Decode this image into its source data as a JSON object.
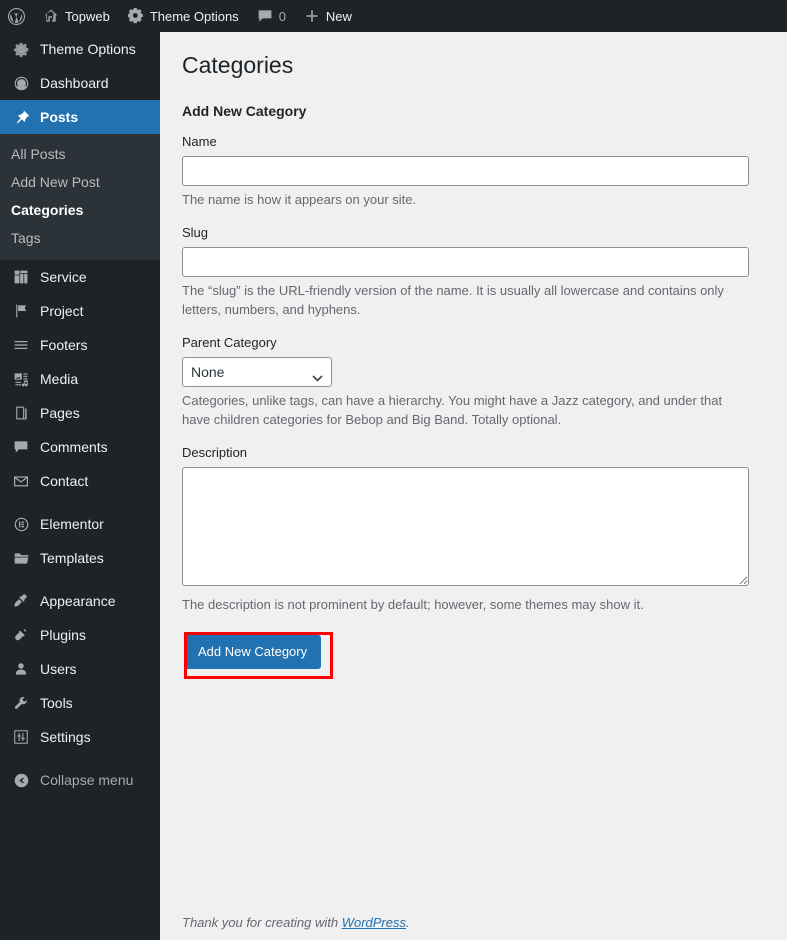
{
  "adminbar": {
    "logo_icon": "wordpress-logo-icon",
    "items": [
      {
        "label": "Topweb",
        "icon": "home-icon"
      },
      {
        "label": "Theme Options",
        "icon": "gear-icon"
      },
      {
        "label": "0",
        "icon": "comment-bubble-icon"
      },
      {
        "label": "New",
        "icon": "plus-icon"
      }
    ]
  },
  "sidebar": {
    "items": [
      {
        "label": "Theme Options",
        "icon": "gear-icon",
        "current": false
      },
      {
        "label": "Dashboard",
        "icon": "dashboard-icon",
        "current": false
      },
      {
        "label": "Posts",
        "icon": "pin-icon",
        "current": true
      },
      {
        "label": "Service",
        "icon": "layout-blocks-icon",
        "current": false
      },
      {
        "label": "Project",
        "icon": "flag-icon",
        "current": false
      },
      {
        "label": "Footers",
        "icon": "menu-lines-icon",
        "current": false
      },
      {
        "label": "Media",
        "icon": "media-icon",
        "current": false
      },
      {
        "label": "Pages",
        "icon": "pages-icon",
        "current": false
      },
      {
        "label": "Comments",
        "icon": "comment-bubble-icon",
        "current": false
      },
      {
        "label": "Contact",
        "icon": "envelope-icon",
        "current": false
      },
      {
        "label": "Elementor",
        "icon": "elementor-icon",
        "current": false
      },
      {
        "label": "Templates",
        "icon": "folder-icon",
        "current": false
      },
      {
        "label": "Appearance",
        "icon": "paintbrush-icon",
        "current": false
      },
      {
        "label": "Plugins",
        "icon": "plug-icon",
        "current": false
      },
      {
        "label": "Users",
        "icon": "user-icon",
        "current": false
      },
      {
        "label": "Tools",
        "icon": "wrench-icon",
        "current": false
      },
      {
        "label": "Settings",
        "icon": "sliders-icon",
        "current": false
      },
      {
        "label": "Collapse menu",
        "icon": "collapse-arrow-icon",
        "current": false
      }
    ],
    "posts_submenu": [
      {
        "label": "All Posts",
        "current": false
      },
      {
        "label": "Add New Post",
        "current": false
      },
      {
        "label": "Categories",
        "current": true
      },
      {
        "label": "Tags",
        "current": false
      }
    ]
  },
  "main": {
    "page_title": "Categories",
    "form_title": "Add New Category",
    "fields": {
      "name": {
        "label": "Name",
        "value": "",
        "placeholder": "",
        "description": "The name is how it appears on your site."
      },
      "slug": {
        "label": "Slug",
        "value": "",
        "placeholder": "",
        "description": "The “slug” is the URL-friendly version of the name. It is usually all lowercase and contains only letters, numbers, and hyphens."
      },
      "parent": {
        "label": "Parent Category",
        "selected": "None",
        "options": [
          "None"
        ],
        "description": "Categories, unlike tags, can have a hierarchy. You might have a Jazz category, and under that have children categories for Bebop and Big Band. Totally optional."
      },
      "description_field": {
        "label": "Description",
        "value": "",
        "description": "The description is not prominent by default; however, some themes may show it."
      }
    },
    "submit_button": "Add New Category"
  },
  "footer": {
    "text_before": "Thank you for creating with ",
    "link": "WordPress",
    "text_after": "."
  },
  "colors": {
    "admin_blue": "#2271b1",
    "sidebar_bg": "#1d2327",
    "submenu_bg": "#2c3338",
    "content_bg": "#f0f0f1",
    "highlight_red": "#ff0000"
  }
}
